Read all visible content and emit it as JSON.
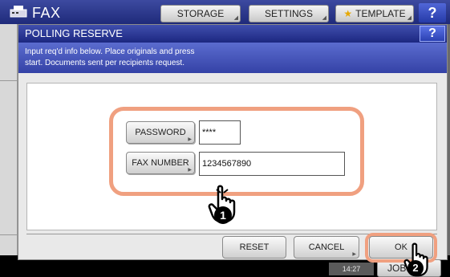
{
  "app": {
    "title": "FAX",
    "tabs": [
      {
        "label": "STORAGE"
      },
      {
        "label": "SETTINGS"
      },
      {
        "label": "TEMPLATE"
      }
    ],
    "help_label": "?"
  },
  "dialog": {
    "title": "POLLING RESERVE",
    "help_label": "?",
    "message_line1": "Input req'd info below. Place originals and press",
    "message_line2": "start. Documents sent per recipients request.",
    "fields": {
      "password": {
        "button_label": "PASSWORD",
        "value": "****"
      },
      "fax_number": {
        "button_label": "FAX NUMBER",
        "value": "1234567890"
      }
    },
    "actions": {
      "reset_label": "RESET",
      "cancel_label": "CANCEL",
      "ok_label": "OK"
    }
  },
  "status": {
    "time": "14:27",
    "job_label": "JOB STATUS"
  },
  "callouts": [
    "1",
    "2"
  ],
  "colors": {
    "title_bar": "#1c2780",
    "message_bar": "#4455bb",
    "callout_highlight": "#f0a080"
  }
}
